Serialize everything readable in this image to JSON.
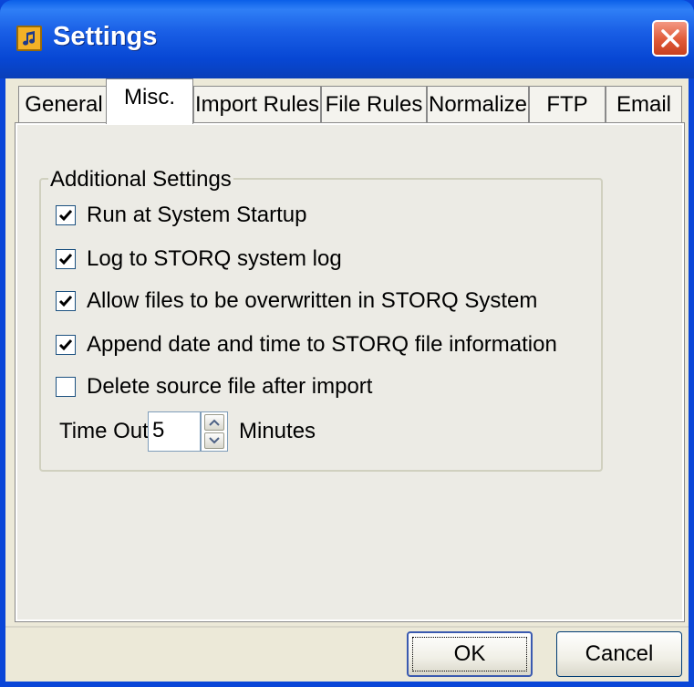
{
  "window": {
    "title": "Settings",
    "icons": {
      "app": "music-note-icon",
      "close": "close-icon"
    }
  },
  "tabs": [
    {
      "label": "General",
      "active": false
    },
    {
      "label": "Misc.",
      "active": true
    },
    {
      "label": "Import Rules",
      "active": false
    },
    {
      "label": "File Rules",
      "active": false
    },
    {
      "label": "Normalize",
      "active": false
    },
    {
      "label": "FTP",
      "active": false
    },
    {
      "label": "Email",
      "active": false
    }
  ],
  "additional_settings": {
    "group_label": "Additional Settings",
    "options": [
      {
        "label": "Run at System Startup",
        "checked": true
      },
      {
        "label": "Log to STORQ system log",
        "checked": true
      },
      {
        "label": "Allow files to be overwritten in STORQ System",
        "checked": true
      },
      {
        "label": "Append date and time to STORQ file information",
        "checked": true
      },
      {
        "label": "Delete source file after import",
        "checked": false
      }
    ],
    "timeout": {
      "label": "Time Out:",
      "value": "5",
      "unit": "Minutes"
    }
  },
  "footer": {
    "ok_label": "OK",
    "cancel_label": "Cancel"
  },
  "colors": {
    "titlebar": "#0a5fe8",
    "close": "#e05a38",
    "face": "#ece9d8"
  }
}
